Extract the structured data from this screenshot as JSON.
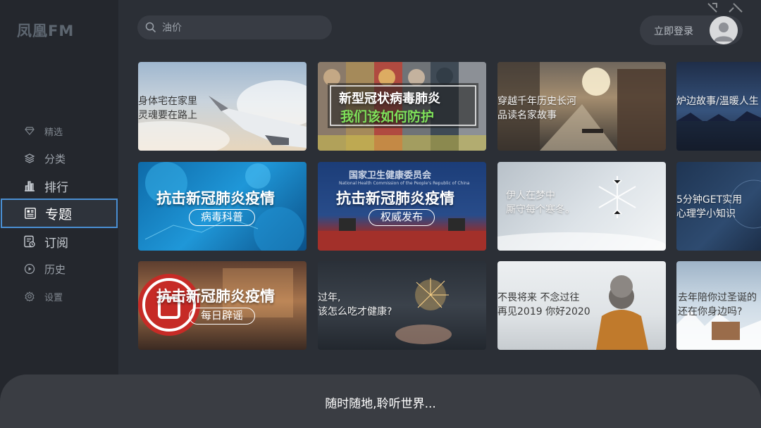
{
  "app": {
    "logo": "凤凰FM"
  },
  "sidebar": {
    "items": [
      {
        "label": "精选",
        "icon": "diamond-icon"
      },
      {
        "label": "分类",
        "icon": "layers-icon"
      },
      {
        "label": "排行",
        "icon": "bar-chart-icon"
      },
      {
        "label": "专题",
        "icon": "article-icon",
        "active": true
      },
      {
        "label": "订阅",
        "icon": "subscribe-icon"
      },
      {
        "label": "历史",
        "icon": "play-circle-icon"
      },
      {
        "label": "设置",
        "icon": "gear-icon"
      }
    ]
  },
  "search": {
    "placeholder": "油价",
    "icon": "search-icon"
  },
  "header": {
    "login_label": "立即登录",
    "avatar_icon": "user-avatar-icon"
  },
  "topics": [
    {
      "caption": "身体宅在家里\n灵魂要在路上"
    },
    {
      "title": "新型冠状病毒肺炎",
      "subtitle": "我们该如何防护"
    },
    {
      "caption": "穿越千年历史长河\n品读名家故事"
    },
    {
      "caption": "炉边故事/温暖人生"
    },
    {
      "title": "抗击新冠肺炎疫情",
      "tag": "病毒科普"
    },
    {
      "header": "国家卫生健康委员会",
      "subheader": "National Health Commission of the People's Republic of China",
      "title": "抗击新冠肺炎疫情",
      "tag": "权威发布"
    },
    {
      "caption": "伊人在梦中\n厮守每个寒冬。"
    },
    {
      "caption": "5分钟GET实用\n心理学小知识"
    },
    {
      "title": "抗击新冠肺炎疫情",
      "tag": "每日辟谣"
    },
    {
      "caption": "过年,\n该怎么吃才健康?"
    },
    {
      "caption": "不畏将来 不念过往\n再见2019 你好2020"
    },
    {
      "caption": "去年陪你过圣诞的\n还在你身边吗?"
    }
  ],
  "bottom_bar": {
    "text": "随时随地,聆听世界..."
  },
  "colors": {
    "accent": "#4a8fd3",
    "background": "#2b2f36",
    "sidebar": "#24272d"
  }
}
